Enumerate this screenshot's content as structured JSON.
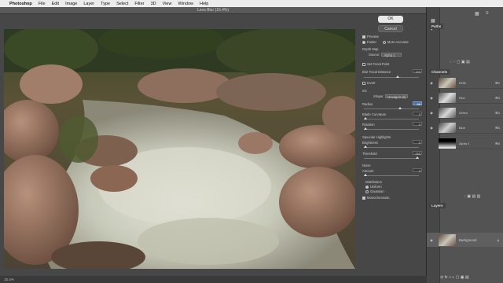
{
  "menubar": {
    "apple": "",
    "app": "Photoshop",
    "items": [
      "File",
      "Edit",
      "Image",
      "Layer",
      "Type",
      "Select",
      "Filter",
      "3D",
      "View",
      "Window",
      "Help"
    ]
  },
  "dialog": {
    "title": "Lens Blur (15.4%)",
    "ok": "OK",
    "cancel": "Cancel",
    "preview": "Preview",
    "faster": "Faster",
    "more_accurate": "More Accurate",
    "depth_map": "Depth Map",
    "source_label": "Source:",
    "source_value": "Alpha 1",
    "set_focal_point": "Set Focal Point",
    "blur_focal_distance": "Blur Focal Distance",
    "blur_focal_value": "159",
    "invert": "Invert",
    "iris": "Iris",
    "shape_label": "Shape:",
    "shape_value": "Hexagon (6)",
    "radius": "Radius",
    "radius_value": "66",
    "blade_curvature": "Blade Curvature",
    "blade_value": "0",
    "rotation": "Rotation",
    "rotation_value": "0",
    "specular": "Specular Highlights",
    "brightness": "Brightness",
    "brightness_value": "0",
    "threshold": "Threshold",
    "threshold_value": "255",
    "noise": "Noise",
    "amount": "Amount",
    "amount_value": "0",
    "distribution": "Distribution",
    "uniform": "Uniform",
    "gaussian": "Gaussian",
    "monochromatic": "Monochromatic",
    "zoom": "15.4%"
  },
  "sliders": {
    "blur_focal": 0.62,
    "radius": 0.66,
    "blade": 0.0,
    "rotation": 0.0,
    "brightness": 0.0,
    "threshold": 1.0,
    "amount": 0.0
  },
  "panels": {
    "paths_tab": "Paths",
    "channels_tab": "Channels",
    "layers_tab": "Layers",
    "channels": [
      {
        "name": "RGB",
        "shortcut": "⌘2"
      },
      {
        "name": "Red",
        "shortcut": "⌘3"
      },
      {
        "name": "Green",
        "shortcut": "⌘4"
      },
      {
        "name": "Blue",
        "shortcut": "⌘5"
      },
      {
        "name": "Alpha 1",
        "shortcut": "⌘6"
      }
    ],
    "layer_name": "Background"
  },
  "colors": {
    "dialog_bg": "#474747",
    "panel_bg": "#535353",
    "highlight": "#4a6fa0"
  }
}
